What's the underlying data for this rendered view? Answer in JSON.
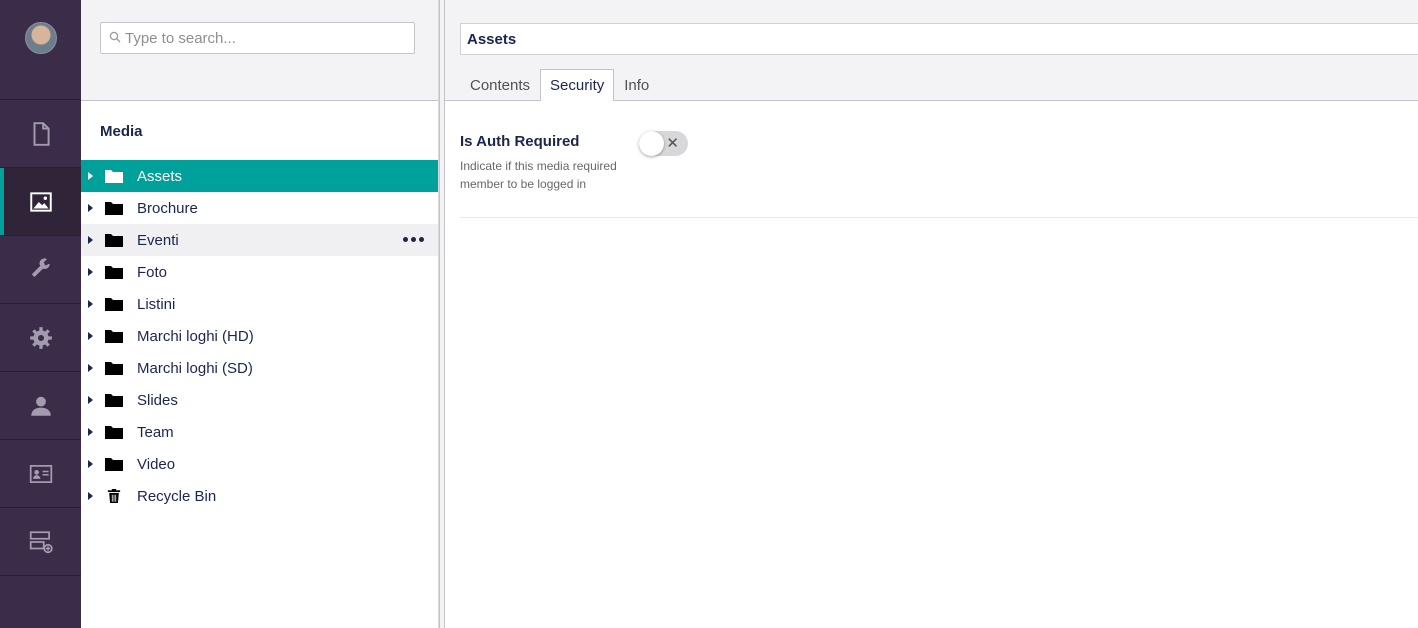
{
  "search": {
    "placeholder": "Type to search..."
  },
  "tree": {
    "title": "Media",
    "items": [
      {
        "label": "Assets",
        "icon": "folder-icon",
        "state": "selected"
      },
      {
        "label": "Brochure",
        "icon": "folder-icon"
      },
      {
        "label": "Eventi",
        "icon": "folder-icon",
        "state": "hover"
      },
      {
        "label": "Foto",
        "icon": "folder-icon"
      },
      {
        "label": "Listini",
        "icon": "folder-icon"
      },
      {
        "label": "Marchi loghi (HD)",
        "icon": "folder-icon"
      },
      {
        "label": "Marchi loghi (SD)",
        "icon": "folder-icon"
      },
      {
        "label": "Slides",
        "icon": "folder-icon"
      },
      {
        "label": "Team",
        "icon": "folder-icon"
      },
      {
        "label": "Video",
        "icon": "folder-icon"
      },
      {
        "label": "Recycle Bin",
        "icon": "trash-icon"
      }
    ]
  },
  "nav": {
    "items": [
      {
        "icon": "document-icon"
      },
      {
        "icon": "image-icon",
        "active": true
      },
      {
        "icon": "wrench-icon"
      },
      {
        "icon": "gear-icon"
      },
      {
        "icon": "user-icon"
      },
      {
        "icon": "id-card-icon"
      },
      {
        "icon": "form-icon"
      }
    ]
  },
  "editor": {
    "name": "Assets",
    "tabs": [
      {
        "label": "Contents"
      },
      {
        "label": "Security",
        "active": true
      },
      {
        "label": "Info"
      }
    ],
    "property": {
      "label": "Is Auth Required",
      "description": "Indicate if this media required member to be logged in",
      "toggle_symbol": "✕",
      "value": false
    }
  },
  "colors": {
    "nav_bg": "#3b2d4a",
    "accent": "#00a19b",
    "text": "#1b264f"
  }
}
